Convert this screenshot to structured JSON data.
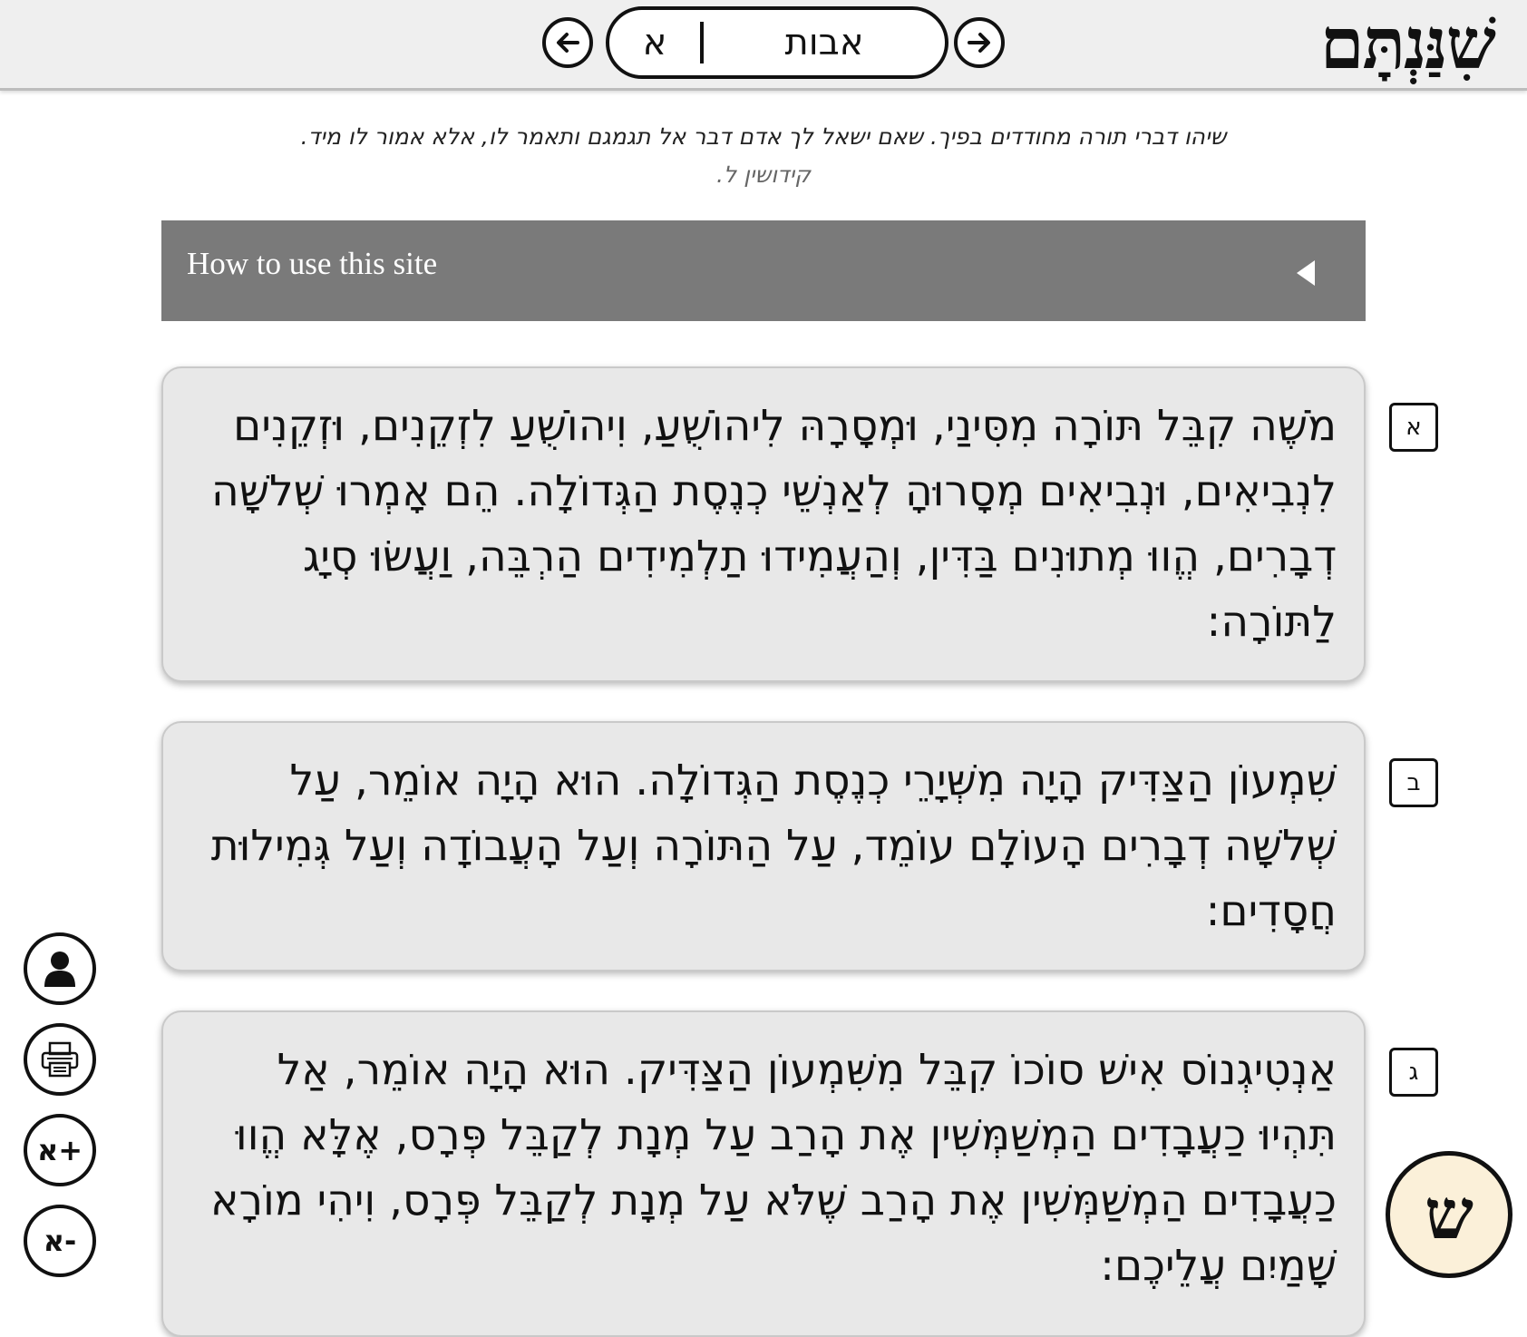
{
  "header": {
    "logo": "שִׁנַּנְתָּם",
    "tractate": "אבות",
    "chapter": "א",
    "prev_icon": "arrow-left-icon",
    "next_icon": "arrow-right-icon"
  },
  "quote": {
    "text": "שיהו דברי תורה מחודדים בפיך. שאם ישאל לך אדם דבר אל תגמגם ותאמר לו, אלא אמור לו מיד.",
    "source": "קידושין ל."
  },
  "howto": {
    "label": "How to use this site",
    "icon": "triangle-left-icon"
  },
  "mishnayot": [
    {
      "num": "א",
      "text": "מֹשֶׁה קִבֵּל תּוֹרָה מִסִּינַי, וּמְסָרָהּ לִיהוֹשֻׁעַ, וִיהוֹשֻׁעַ לִזְקֵנִים, וּזְקֵנִים לִנְבִיאִים, וּנְבִיאִים מְסָרוּהָ לְאַנְשֵׁי כְנֶסֶת הַגְּדוֹלָה. הֵם אָמְרוּ שְׁלשָׁה דְבָרִים, הֱווּ מְתוּנִים בַּדִּין, וְהַעֲמִידוּ תַלְמִידִים הַרְבֵּה, וַעֲשׂוּ סְיָג לַתּוֹרָה:"
    },
    {
      "num": "ב",
      "text": "שִׁמְעוֹן הַצַּדִּיק הָיָה מִשְּׁיָרֵי כְנֶסֶת הַגְּדוֹלָה. הוּא הָיָה אוֹמֵר, עַל שְׁלשָׁה דְבָרִים הָעוֹלָם עוֹמֵד, עַל הַתּוֹרָה וְעַל הָעֲבוֹדָה וְעַל גְּמִילוּת חֲסָדִים:"
    },
    {
      "num": "ג",
      "text": "אַנְטִיגְנוֹס אִישׁ סוֹכוֹ קִבֵּל מִשִּׁמְעוֹן הַצַּדִּיק. הוּא הָיָה אוֹמֵר, אַל תִּהְיוּ כַעֲבָדִים הַמְשַׁמְּשִׁין אֶת הָרַב עַל מְנָת לְקַבֵּל פְּרָס, אֶלָּא הֱווּ כַעֲבָדִים הַמְשַׁמְּשִׁין אֶת הָרַב שֶׁלֹּא עַל מְנָת לְקַבֵּל פְּרָס, וִיהִי מוֹרָא שָׁמַיִם עֲלֵיכֶם:"
    }
  ],
  "tools": {
    "account_icon": "person-icon",
    "print_icon": "printer-icon",
    "font_increase": "א+",
    "font_decrease": "א-",
    "logo_button": "ש"
  },
  "colors": {
    "header_bg": "#efefef",
    "howto_bg": "#7a7a7a",
    "card_bg": "#e8e8e8",
    "logo_button_bg": "#fbf0d9"
  }
}
